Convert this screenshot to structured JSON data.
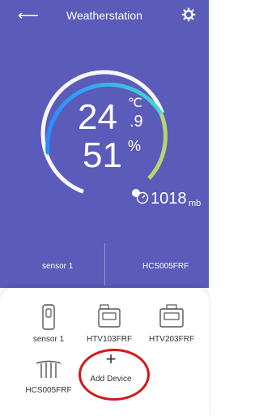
{
  "header": {
    "title": "Weatherstation",
    "back_icon": "back-arrow-icon",
    "settings_icon": "gear-icon"
  },
  "reading": {
    "temperature_int": "24",
    "temperature_dec": ".9",
    "temperature_unit": "℃",
    "humidity": "51",
    "humidity_unit": "%",
    "pressure": "1018",
    "pressure_unit": "mb"
  },
  "sensors_bar": {
    "left": "sensor 1",
    "right": "HCS005FRF"
  },
  "devices": [
    {
      "label": "sensor 1",
      "icon": "sensor-icon"
    },
    {
      "label": "HTV103FRF",
      "icon": "thermostat-valve-icon"
    },
    {
      "label": "HTV203FRF",
      "icon": "dual-valve-icon"
    },
    {
      "label": "HCS005FRF",
      "icon": "temperature-probe-icon"
    }
  ],
  "add_device": {
    "label": "Add Device",
    "icon": "plus-icon"
  },
  "colors": {
    "background": "#5b5bb9",
    "highlight": "#d31818"
  }
}
